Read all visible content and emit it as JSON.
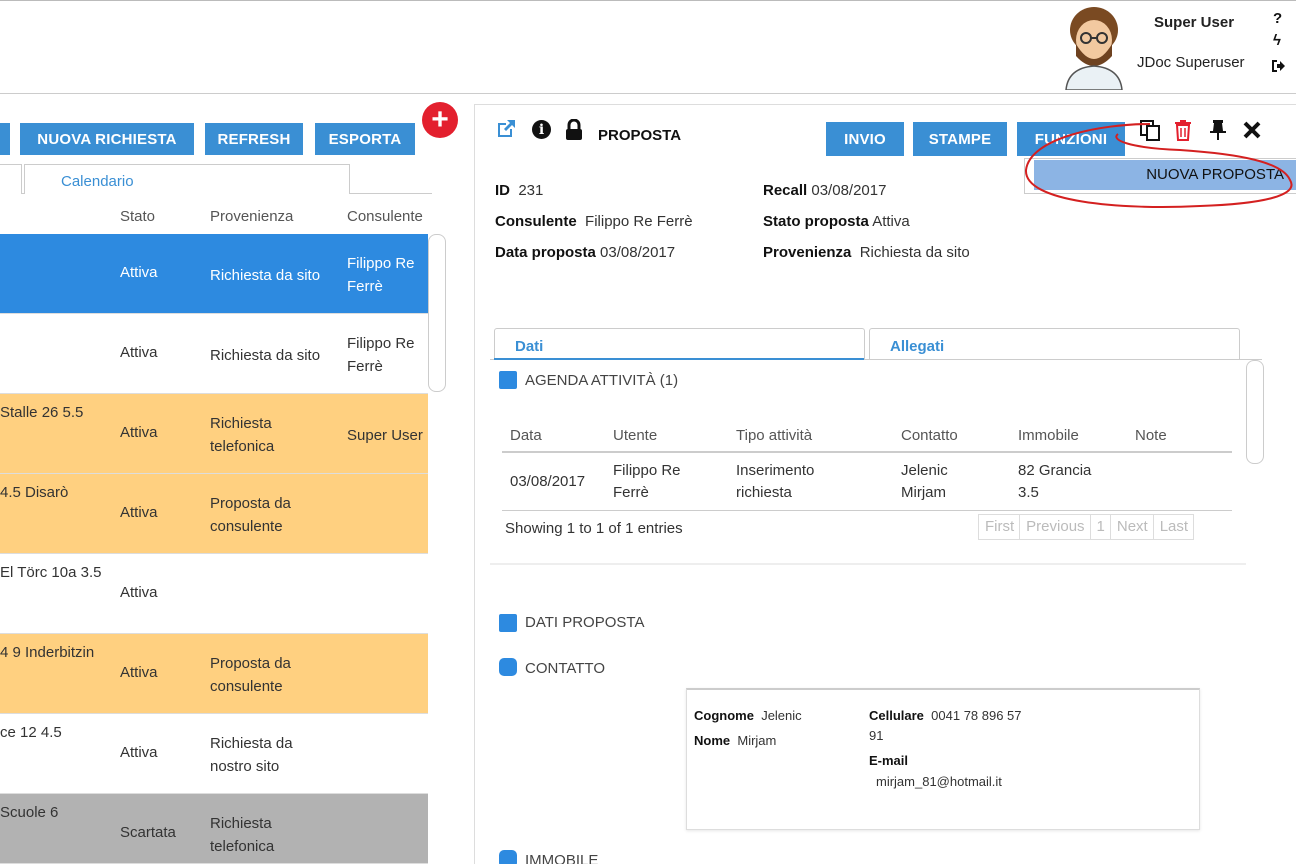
{
  "header": {
    "user_name": "Super User",
    "user_role": "JDoc Superuser",
    "help_symbol": "?",
    "bolt_symbol": "ϟ",
    "logout_symbol": "↪"
  },
  "list": {
    "buttons": {
      "new_request": "NUOVA RICHIESTA",
      "refresh": "REFRESH",
      "export": "ESPORTA"
    },
    "add_symbol": "+",
    "tab_calendar": "Calendario",
    "columns": {
      "stato": "Stato",
      "provenienza": "Provenienza",
      "consulente": "Consulente"
    },
    "rows": [
      {
        "addr": "",
        "stato": "Attiva",
        "prov1": "Richiesta da sito",
        "prov2": "",
        "cons1": "Filippo Re",
        "cons2": "Ferrè"
      },
      {
        "addr": "",
        "stato": "Attiva",
        "prov1": "Richiesta da sito",
        "prov2": "",
        "cons1": "Filippo Re",
        "cons2": "Ferrè"
      },
      {
        "addr": "Stalle 26 5.5",
        "stato": "Attiva",
        "prov1": "Richiesta",
        "prov2": "telefonica",
        "cons1": "Super User",
        "cons2": ""
      },
      {
        "addr": "4.5 Disarò",
        "stato": "Attiva",
        "prov1": "Proposta da",
        "prov2": "consulente",
        "cons1": "",
        "cons2": ""
      },
      {
        "addr": "El Törc 10a 3.5",
        "stato": "Attiva",
        "prov1": "",
        "prov2": "",
        "cons1": "",
        "cons2": ""
      },
      {
        "addr": "4 9 Inderbitzin",
        "stato": "Attiva",
        "prov1": "Proposta da",
        "prov2": "consulente",
        "cons1": "",
        "cons2": ""
      },
      {
        "addr": "ce 12 4.5",
        "stato": "Attiva",
        "prov1": "Richiesta da",
        "prov2": "nostro sito",
        "cons1": "",
        "cons2": ""
      },
      {
        "addr": "Scuole 6",
        "stato": "Scartata",
        "prov1": "Richiesta",
        "prov2": "telefonica",
        "cons1": "",
        "cons2": ""
      }
    ]
  },
  "detail": {
    "title": "PROPOSTA",
    "buttons": {
      "invio": "INVIO",
      "stampe": "STAMPE",
      "funzioni": "FUNZIONI"
    },
    "dropdown_item": "NUOVA PROPOSTA",
    "fields": {
      "id_label": "ID",
      "id_value": "231",
      "consulente_label": "Consulente",
      "consulente_value": "Filippo Re Ferrè",
      "data_label": "Data proposta",
      "data_value": "03/08/2017",
      "recall_label": "Recall",
      "recall_value": "03/08/2017",
      "stato_label": "Stato proposta",
      "stato_value": "Attiva",
      "provenienza_label": "Provenienza",
      "provenienza_value": "Richiesta da sito"
    },
    "tabs": {
      "dati": "Dati",
      "allegati": "Allegati"
    },
    "agenda": {
      "title": "AGENDA ATTIVITÀ (1)",
      "columns": [
        "Data",
        "Utente",
        "Tipo attività",
        "Contatto",
        "Immobile",
        "Note"
      ],
      "row": {
        "data": "03/08/2017",
        "utente1": "Filippo Re",
        "utente2": "Ferrè",
        "tipo1": "Inserimento",
        "tipo2": "richiesta",
        "contatto1": "Jelenic",
        "contatto2": "Mirjam",
        "immobile1": "82 Grancia",
        "immobile2": "3.5",
        "note": ""
      },
      "showing": "Showing 1 to 1 of 1 entries",
      "pager": [
        "First",
        "Previous",
        "1",
        "Next",
        "Last"
      ]
    },
    "sections": {
      "dati_proposta": "DATI PROPOSTA",
      "contatto": "CONTATTO",
      "immobile": "IMMOBILE"
    },
    "contact": {
      "cognome_label": "Cognome",
      "cognome_value": "Jelenic",
      "nome_label": "Nome",
      "nome_value": "Mirjam",
      "cellulare_label": "Cellulare",
      "cellulare_value1": "0041 78 896 57",
      "cellulare_value2": "91",
      "email_label": "E-mail",
      "email_value": "mirjam_81@hotmail.it"
    }
  },
  "colors": {
    "primary": "#3a8fd4",
    "selected_row": "#2d8ae0",
    "orange_row": "#ffd080",
    "gray_row": "#b2b2b2",
    "add_red": "#e3202e",
    "dropdown": "#8cb4e4",
    "annotation": "#d42020"
  }
}
